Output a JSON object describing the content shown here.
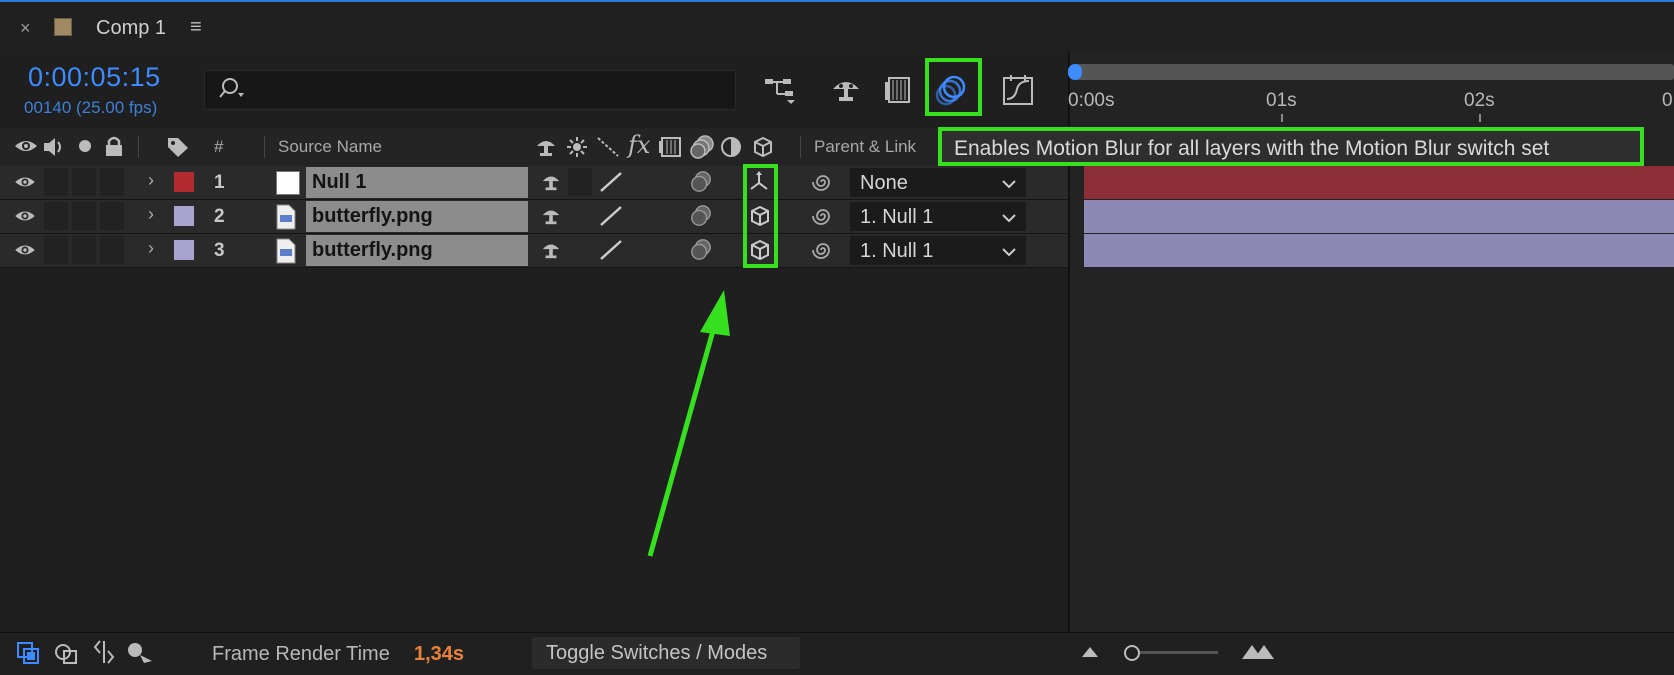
{
  "tab": {
    "close_glyph": "×",
    "title": "Comp 1",
    "menu_glyph": "≡"
  },
  "time": {
    "timecode": "0:00:05:15",
    "frames": "00140 (25.00 fps)"
  },
  "search": {
    "placeholder": "",
    "value": ""
  },
  "headers": {
    "number": "#",
    "source_name": "Source Name",
    "parent_link": "Parent & Link",
    "fx": "fx"
  },
  "tooltip": "Enables Motion Blur for all layers with the Motion Blur switch set",
  "layers": [
    {
      "number": "1",
      "name": "Null 1",
      "parent": "None",
      "label_color": "#b02a30",
      "bar_color": "#8b2e35"
    },
    {
      "number": "2",
      "name": "butterfly.png",
      "parent": "1. Null 1",
      "label_color": "#a9a3cf",
      "bar_color": "#8c88b4"
    },
    {
      "number": "3",
      "name": "butterfly.png",
      "parent": "1. Null 1",
      "label_color": "#a9a3cf",
      "bar_color": "#8c88b4"
    }
  ],
  "timeline": {
    "labels": [
      "0:00s",
      "01s",
      "02s",
      "0"
    ]
  },
  "footer": {
    "frame_render_label": "Frame Render Time",
    "frame_render_value": "1,34s",
    "toggle_label": "Toggle Switches / Modes"
  },
  "colors": {
    "accent_blue": "#3d8bff",
    "highlight_green": "#36e01f",
    "render_time_orange": "#e8823a"
  }
}
